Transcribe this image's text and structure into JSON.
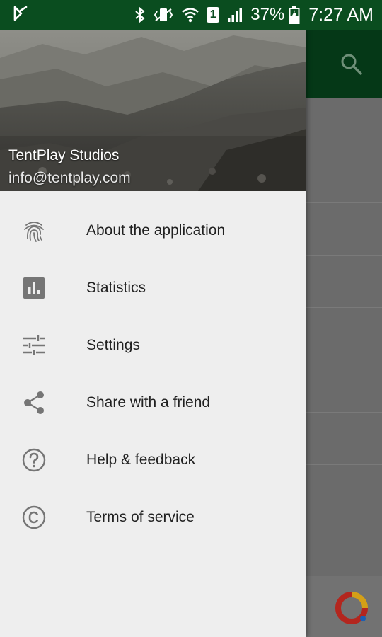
{
  "status_bar": {
    "battery_percent": "37%",
    "time": "7:27 AM",
    "sim_slot": "1",
    "icons": [
      "app-notification-icon",
      "bluetooth-icon",
      "vibrate-icon",
      "wifi-icon",
      "sim-icon",
      "signal-icon",
      "battery-charging-icon"
    ]
  },
  "drawer": {
    "account_name": "TentPlay Studios",
    "account_email": "info@tentplay.com",
    "items": [
      {
        "label": "About the application",
        "icon": "fingerprint-icon"
      },
      {
        "label": "Statistics",
        "icon": "bar-chart-icon"
      },
      {
        "label": "Settings",
        "icon": "sliders-icon"
      },
      {
        "label": "Share with a friend",
        "icon": "share-icon"
      },
      {
        "label": "Help & feedback",
        "icon": "help-icon"
      },
      {
        "label": "Terms of service",
        "icon": "copyright-icon"
      }
    ]
  },
  "colors": {
    "status_bar": "#0a4d1f",
    "toolbar": "#053817",
    "drawer_bg": "#eeeeee",
    "icon": "#757575",
    "text": "#212121"
  }
}
